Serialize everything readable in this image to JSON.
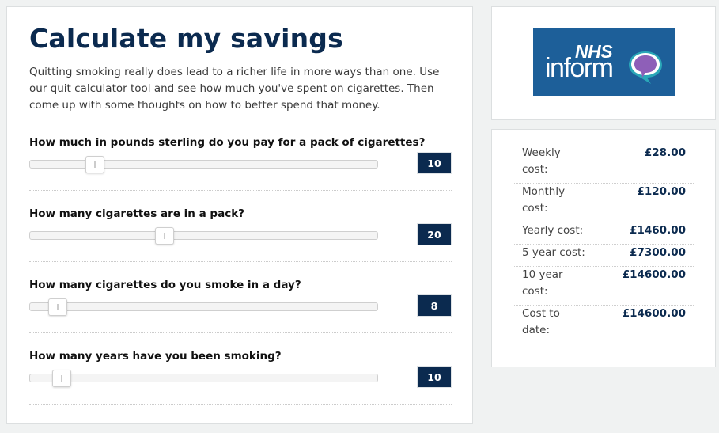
{
  "calculator": {
    "title": "Calculate my savings",
    "intro": "Quitting smoking really does lead to a richer life in more ways than one. Use our quit calculator tool and see how much you've spent on cigarettes. Then come up with some thoughts on how to better spend that money.",
    "questions": [
      {
        "label": "How much in pounds sterling do you pay for a pack of cigarettes?",
        "value": "10",
        "slider_fraction": 0.17
      },
      {
        "label": "How many cigarettes are in a pack?",
        "value": "20",
        "slider_fraction": 0.39
      },
      {
        "label": "How many cigarettes do you smoke in a day?",
        "value": "8",
        "slider_fraction": 0.08
      },
      {
        "label": "How many years have you been smoking?",
        "value": "10",
        "slider_fraction": 0.09
      }
    ]
  },
  "logo": {
    "nhs": "NHS",
    "inform": "inform",
    "background": "#1d5f99",
    "bubble_color": "#8e5fb8",
    "tail_color": "#2aa7b8"
  },
  "results": [
    {
      "label": "Weekly cost:",
      "value": "£28.00"
    },
    {
      "label": "Monthly cost:",
      "value": "£120.00"
    },
    {
      "label": "Yearly cost:",
      "value": "£1460.00"
    },
    {
      "label": "5 year cost:",
      "value": "£7300.00"
    },
    {
      "label": "10 year cost:",
      "value": "£14600.00"
    },
    {
      "label": "Cost to date:",
      "value": "£14600.00"
    }
  ],
  "colors": {
    "heading": "#0b2a4f",
    "value_box": "#0b2a4f",
    "background": "#f0f2f2"
  }
}
